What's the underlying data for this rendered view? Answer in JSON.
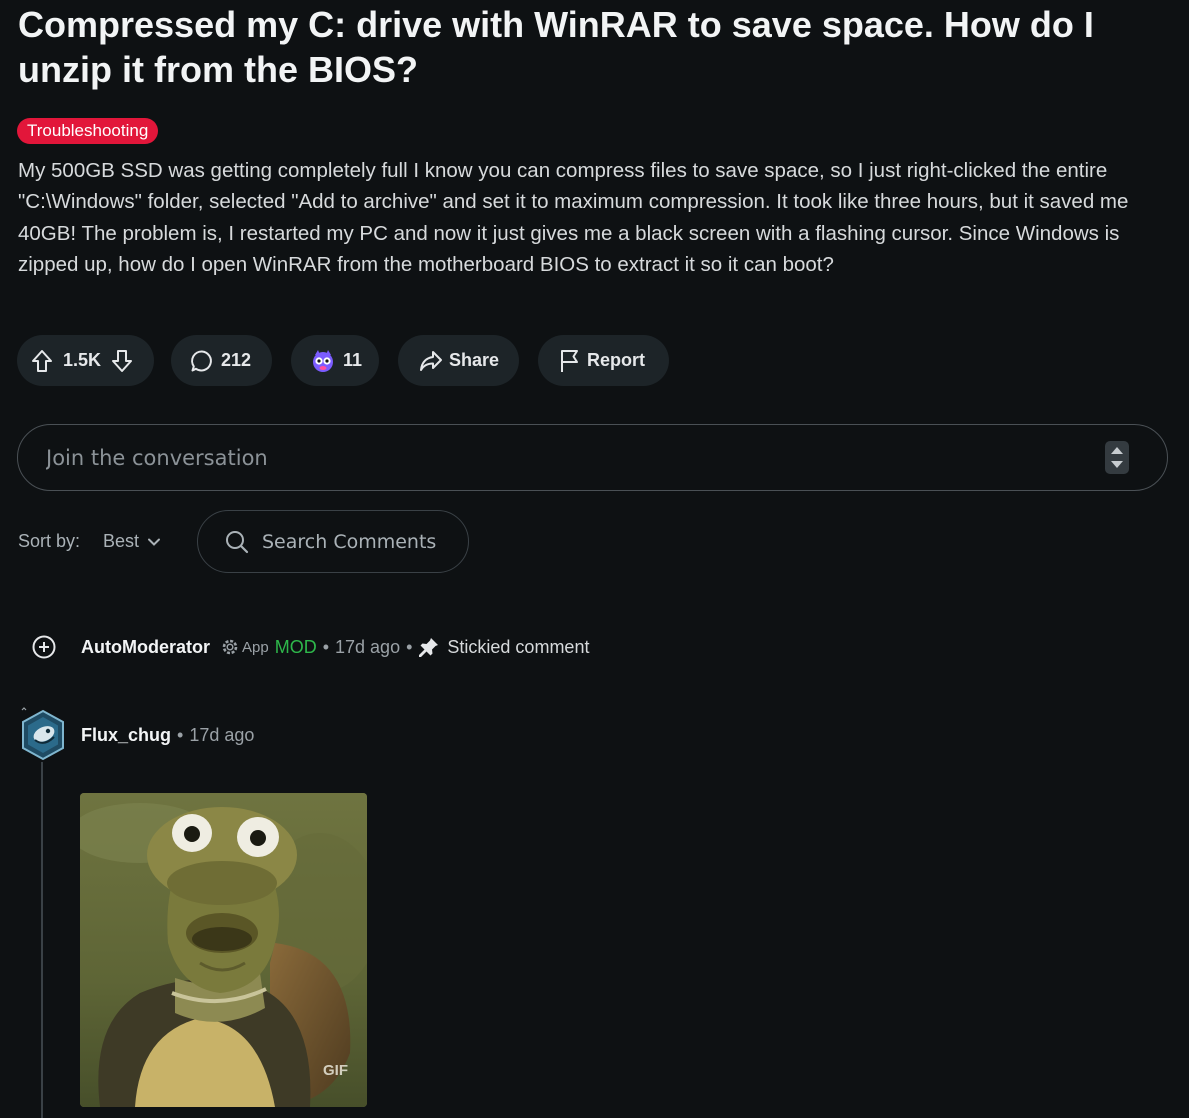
{
  "post": {
    "title": "Compressed my C: drive with WinRAR to save space. How do I unzip it from the BIOS?",
    "flair": "Troubleshooting",
    "body": "My 500GB SSD was getting completely full I know you can compress files to save space, so I just right-clicked the entire \"C:\\Windows\" folder, selected \"Add to archive\" and set it to maximum compression. It took like three hours, but it saved me 40GB! The problem is, I restarted my PC and now it just gives me a black screen with a flashing cursor. Since Windows is zipped up, how do I open WinRAR from the motherboard BIOS to extract it so it can boot?"
  },
  "actions": {
    "votes": "1.5K",
    "comments": "212",
    "awards": "11",
    "share_label": "Share",
    "report_label": "Report"
  },
  "composer": {
    "placeholder": "Join the conversation"
  },
  "sort": {
    "label": "Sort by:",
    "value": "Best",
    "search_label": "Search Comments"
  },
  "comments": [
    {
      "author": "AutoModerator",
      "app_badge": "App",
      "mod_badge": "MOD",
      "separator": "•",
      "time": "17d ago",
      "stickied": "Stickied comment"
    },
    {
      "author": "Flux_chug",
      "separator": "•",
      "time": "17d ago",
      "media_label": "GIF"
    }
  ],
  "colors": {
    "background": "#0e1113",
    "pill": "#1d2428",
    "flair": "#e2163a",
    "mod": "#2eb84b"
  },
  "icons": [
    "upvote-icon",
    "downvote-icon",
    "comment-icon",
    "award-icon",
    "share-icon",
    "report-flag-icon",
    "search-icon",
    "chevron-down-icon",
    "expand-plus-icon",
    "app-gear-icon",
    "pin-icon"
  ]
}
